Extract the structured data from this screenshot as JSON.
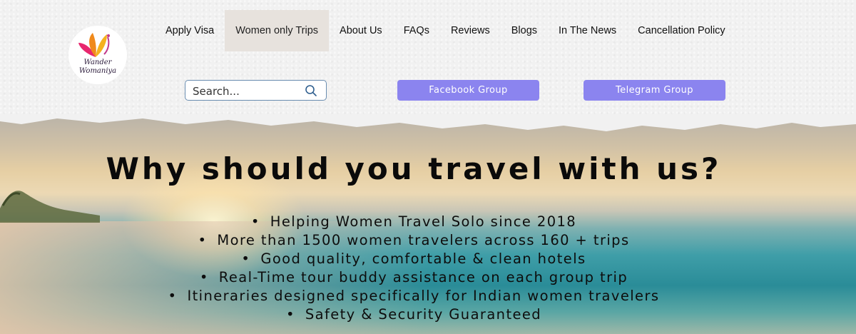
{
  "logo": {
    "line1": "Wander",
    "line2": "Womaniya"
  },
  "nav": {
    "items": [
      {
        "label": "Apply Visa"
      },
      {
        "label": "Women only Trips",
        "active": true
      },
      {
        "label": "About Us"
      },
      {
        "label": "FAQs"
      },
      {
        "label": "Reviews"
      },
      {
        "label": "Blogs"
      },
      {
        "label": "In The News"
      },
      {
        "label": "Cancellation Policy"
      }
    ]
  },
  "search": {
    "placeholder": "Search...",
    "icon": "search-icon"
  },
  "buttons": {
    "facebook": "Facebook Group",
    "telegram": "Telegram Group"
  },
  "hero": {
    "title": "Why should you travel with us?",
    "bullet_char": "•",
    "bullets": [
      "Helping Women Travel Solo since 2018",
      "More than 1500 women travelers across 160 + trips",
      "Good quality, comfortable & clean hotels",
      "Real-Time tour buddy assistance on each group trip",
      "Itineraries designed specifically for Indian women travelers",
      "Safety & Security Guaranteed"
    ]
  },
  "colors": {
    "accent_button": "#8b84ef",
    "active_nav_bg": "#e7e2dd",
    "search_border": "#6a8db0"
  }
}
